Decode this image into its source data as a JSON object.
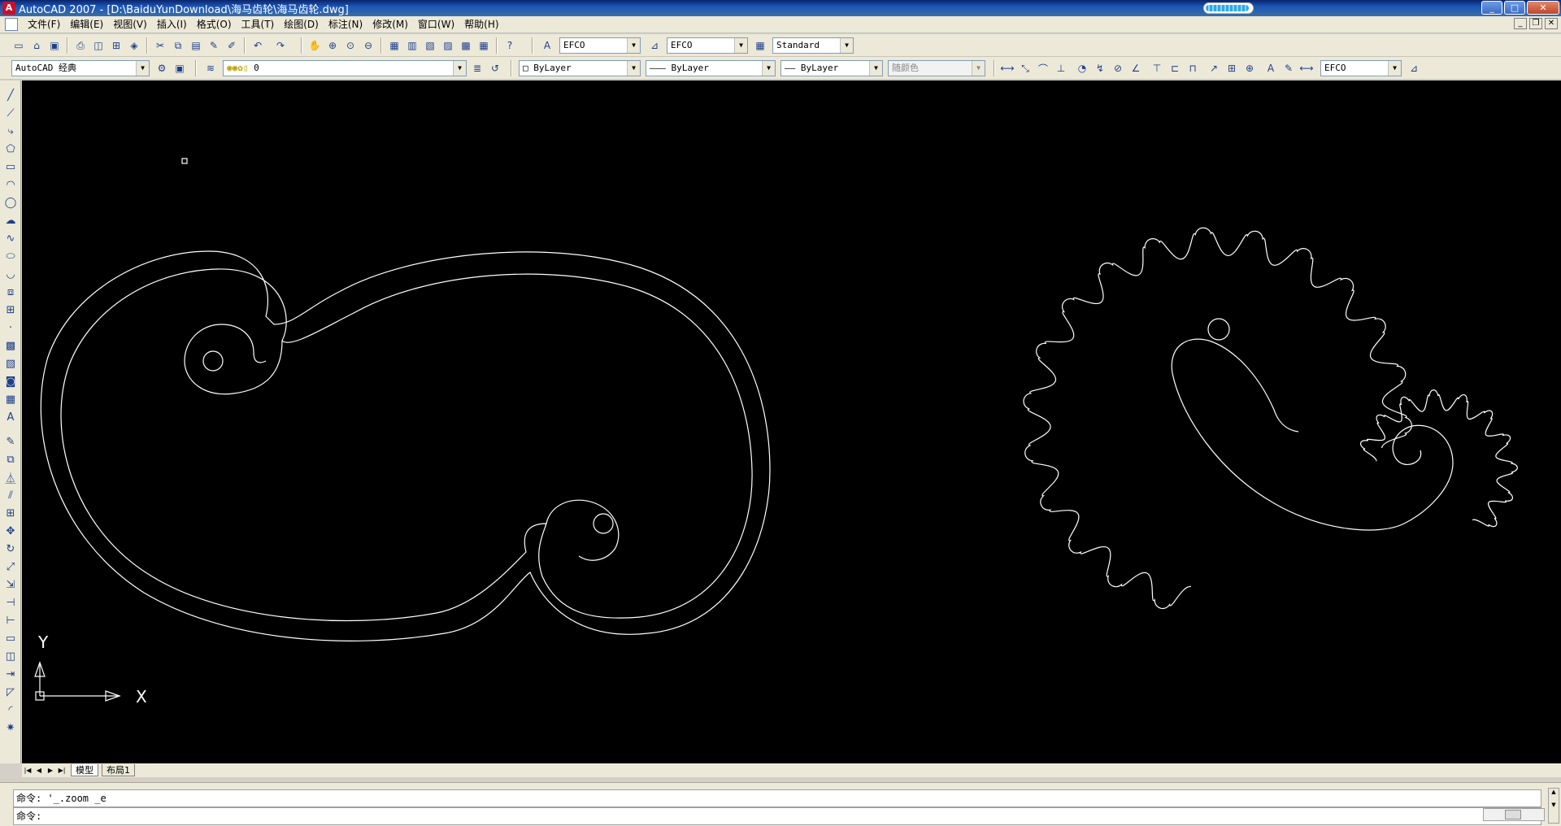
{
  "window": {
    "title": "AutoCAD 2007 - [D:\\BaiduYunDownload\\海马齿轮\\海马齿轮.dwg]",
    "app_icon_glyph": "A",
    "progress_fraction": 0.95
  },
  "window_buttons": {
    "minimize": "_",
    "maximize": "□",
    "close": "✕"
  },
  "mdi_buttons": {
    "minimize": "_",
    "restore": "❐",
    "close": "✕"
  },
  "menu": [
    {
      "label": "文件(F)"
    },
    {
      "label": "编辑(E)"
    },
    {
      "label": "视图(V)"
    },
    {
      "label": "插入(I)"
    },
    {
      "label": "格式(O)"
    },
    {
      "label": "工具(T)"
    },
    {
      "label": "绘图(D)"
    },
    {
      "label": "标注(N)"
    },
    {
      "label": "修改(M)"
    },
    {
      "label": "窗口(W)"
    },
    {
      "label": "帮助(H)"
    }
  ],
  "toolbar1": {
    "text_style": "EFCO",
    "dim_style": "EFCO",
    "table_style": "Standard"
  },
  "toolbar2": {
    "workspace": "AutoCAD 经典",
    "layer": "0",
    "color": "ByLayer",
    "linetype": "ByLayer",
    "lineweight": "ByLayer",
    "plot_style": "随颜色",
    "dim_style2": "EFCO"
  },
  "ucs": {
    "x_label": "X",
    "y_label": "Y"
  },
  "tabs": {
    "model": "模型",
    "layout1": "布局1"
  },
  "command": {
    "history": "命令: '_.zoom _e",
    "prompt": "命令:"
  },
  "colors": {
    "canvas_bg": "#000000",
    "geometry": "#ffffff",
    "chrome": "#ece9d8",
    "titlebar": "#0a246a"
  }
}
